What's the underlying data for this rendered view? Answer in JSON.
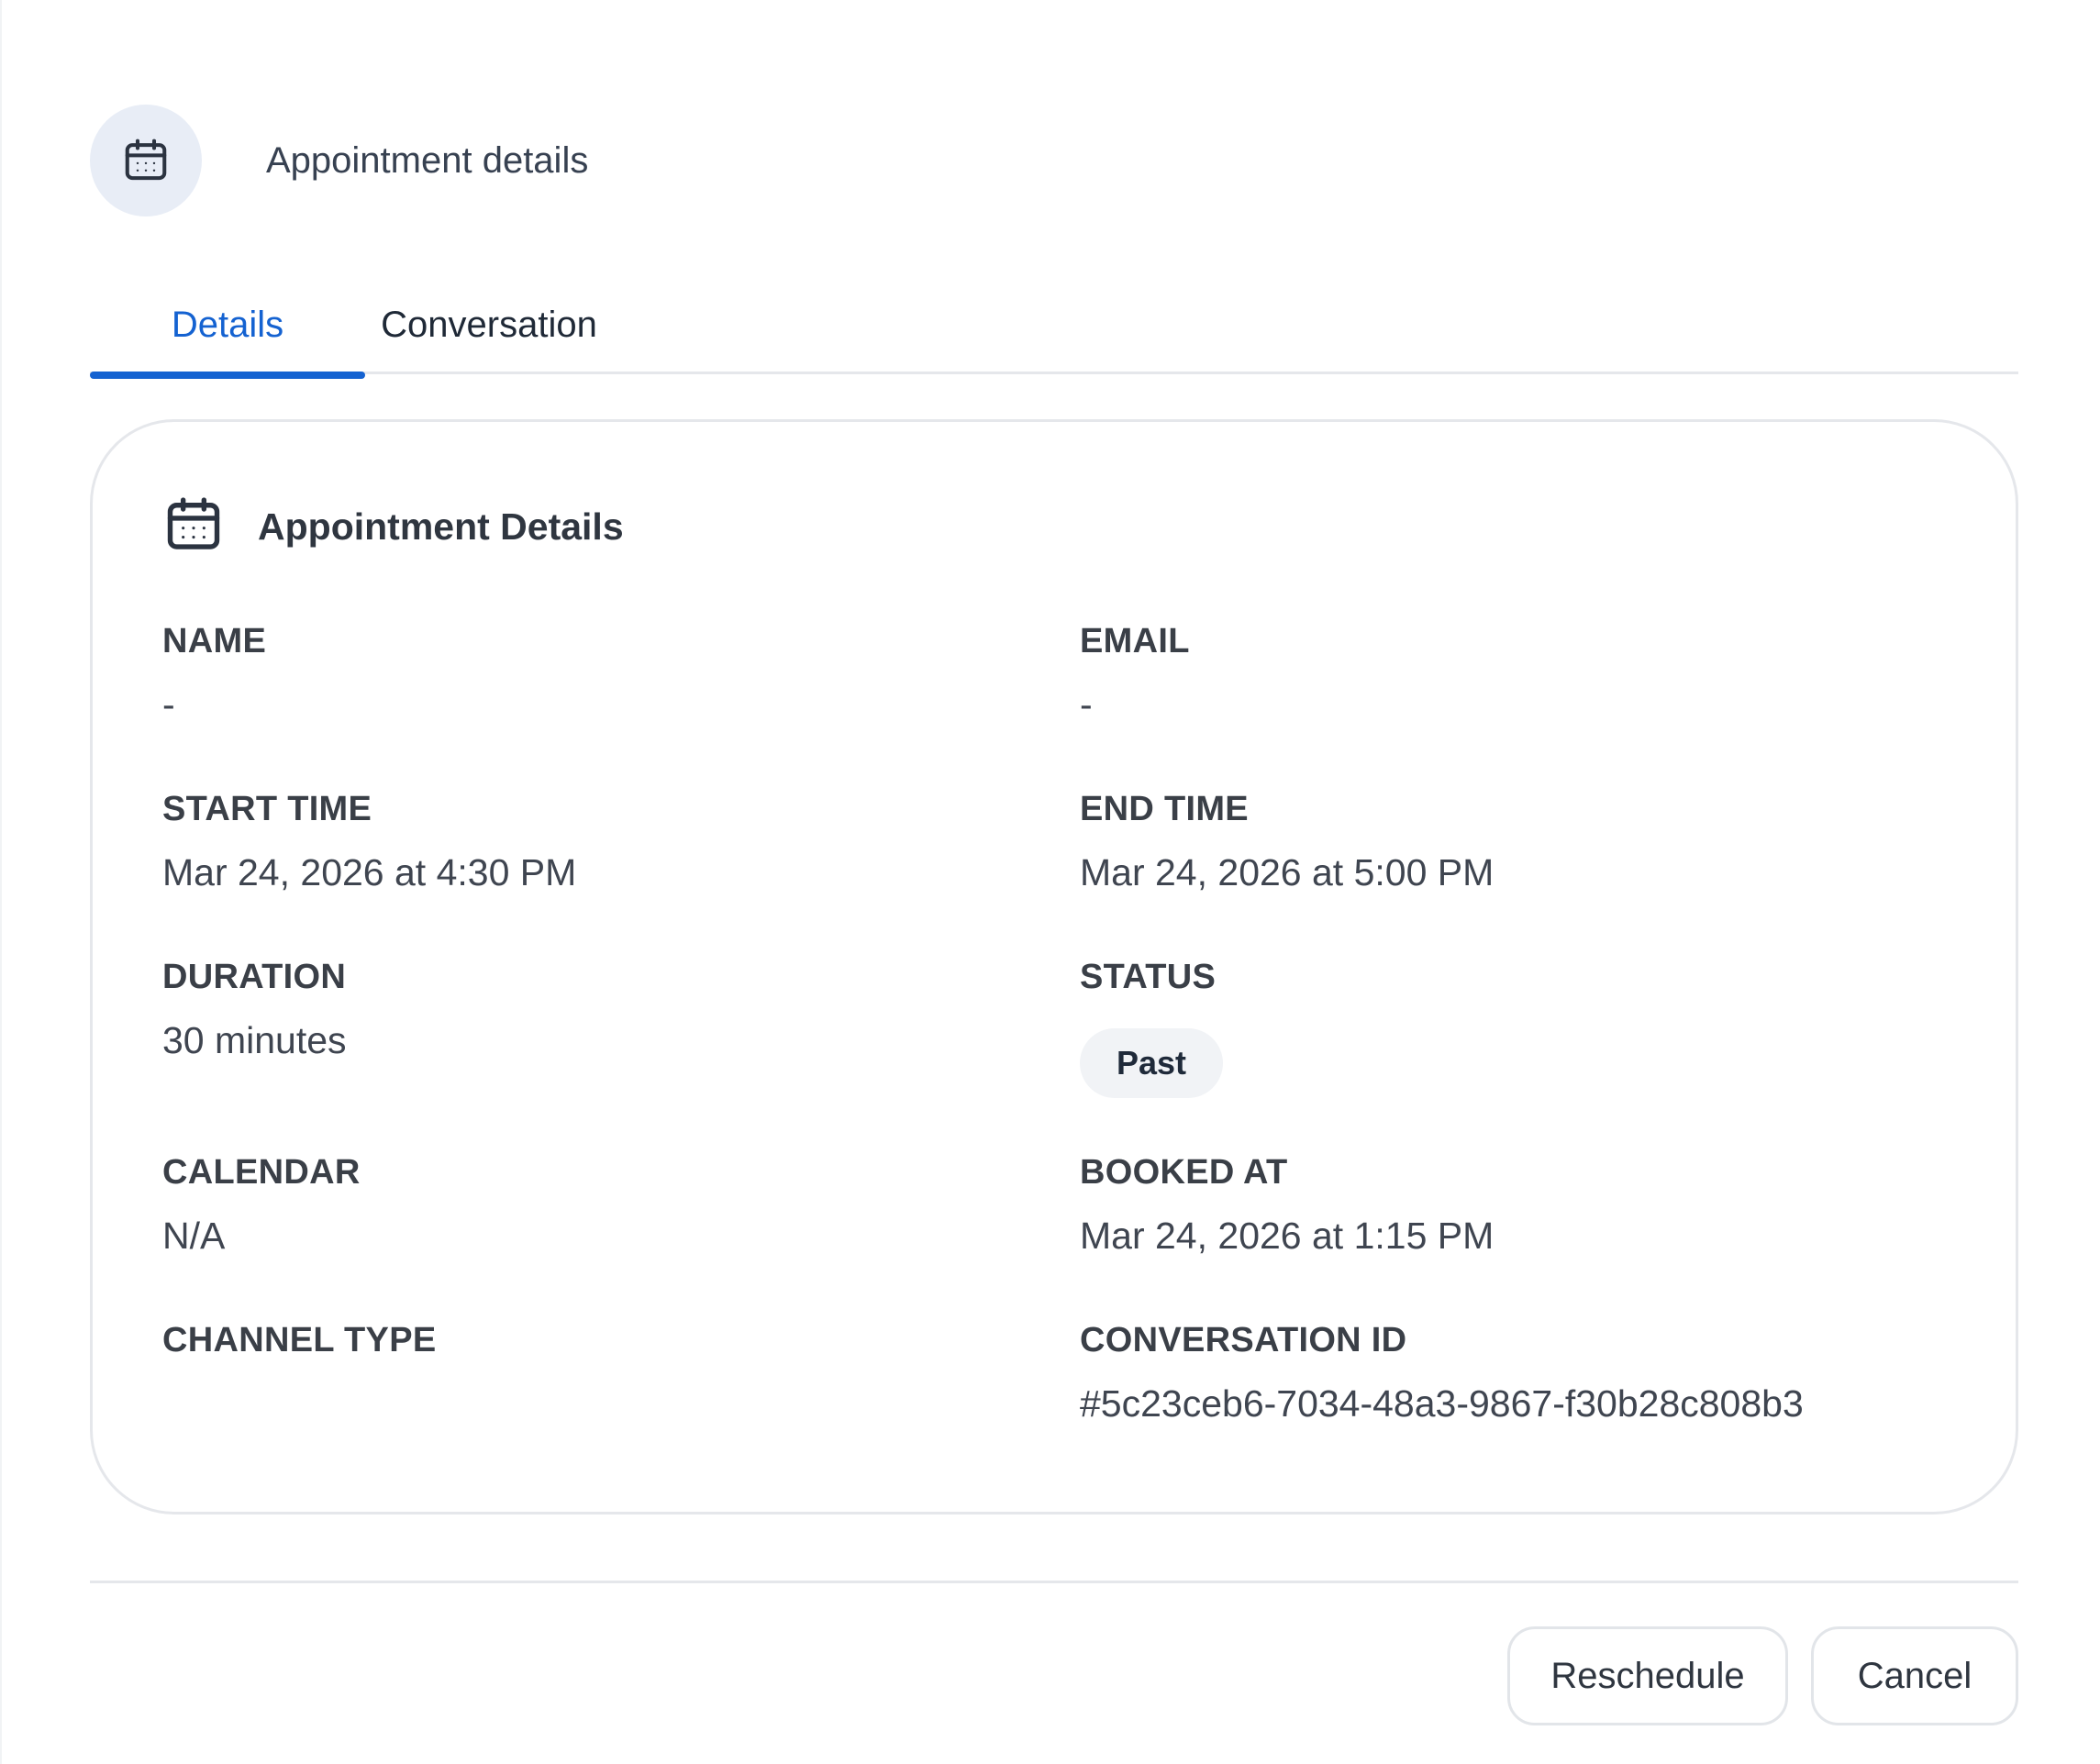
{
  "header": {
    "icon": "calendar-icon",
    "title": "Appointment details"
  },
  "tabs": [
    {
      "label": "Details",
      "active": true
    },
    {
      "label": "Conversation",
      "active": false
    }
  ],
  "card": {
    "icon": "calendar-icon",
    "title": "Appointment Details",
    "fields": {
      "name": {
        "label": "NAME",
        "value": "-"
      },
      "email": {
        "label": "EMAIL",
        "value": "-"
      },
      "start_time": {
        "label": "START TIME",
        "value": "Mar 24, 2026 at 4:30 PM"
      },
      "end_time": {
        "label": "END TIME",
        "value": "Mar 24, 2026 at 5:00 PM"
      },
      "duration": {
        "label": "DURATION",
        "value": "30 minutes"
      },
      "status": {
        "label": "STATUS",
        "value": "Past"
      },
      "calendar": {
        "label": "CALENDAR",
        "value": "N/A"
      },
      "booked_at": {
        "label": "BOOKED AT",
        "value": "Mar 24, 2026 at 1:15 PM"
      },
      "channel_type": {
        "label": "CHANNEL TYPE",
        "value": ""
      },
      "conversation_id": {
        "label": "CONVERSATION ID",
        "value": "#5c23ceb6-7034-48a3-9867-f30b28c808b3"
      }
    }
  },
  "footer": {
    "reschedule_label": "Reschedule",
    "cancel_label": "Cancel"
  },
  "colors": {
    "accent": "#1462d1",
    "icon_bg": "#e8edf6",
    "badge_bg": "#f1f3f6",
    "border": "#e5e7eb"
  }
}
